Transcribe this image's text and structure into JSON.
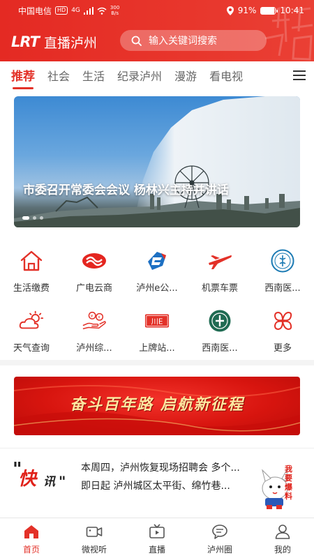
{
  "status_bar": {
    "carrier": "中国电信",
    "hd": "HD",
    "network": "4G",
    "speed_value": "300",
    "speed_unit": "B/s",
    "battery": "91%",
    "battery_level": 0.91,
    "time": "10:41"
  },
  "header": {
    "logo_mark": "LRT",
    "app_name": "直播泸州",
    "search_placeholder": "输入关键词搜索"
  },
  "tabs": [
    {
      "label": "推荐",
      "active": true
    },
    {
      "label": "社会",
      "active": false
    },
    {
      "label": "生活",
      "active": false
    },
    {
      "label": "纪录泸州",
      "active": false
    },
    {
      "label": "漫游",
      "active": false
    },
    {
      "label": "看电视",
      "active": false
    }
  ],
  "banner": {
    "title": "市委召开常委会会议  杨林兴主持并讲话",
    "slide_count": 3,
    "active_slide": 1
  },
  "services": {
    "row1": [
      {
        "label": "生活缴费",
        "icon": "house-icon"
      },
      {
        "label": "广电云商",
        "icon": "cloud-mall-icon"
      },
      {
        "label": "泸州e公...",
        "icon": "bus-e-icon"
      },
      {
        "label": "机票车票",
        "icon": "airplane-icon"
      },
      {
        "label": "西南医...",
        "icon": "hospital-emblem-icon"
      }
    ],
    "row2": [
      {
        "label": "天气查询",
        "icon": "weather-icon"
      },
      {
        "label": "泸州综...",
        "icon": "hand-coins-icon"
      },
      {
        "label": "上牌站...",
        "icon": "license-plate-icon"
      },
      {
        "label": "西南医...",
        "icon": "hospital-emblem-icon"
      },
      {
        "label": "更多",
        "icon": "more-icon"
      }
    ],
    "plate_text": "川E"
  },
  "promo": {
    "slogan": "奋斗百年路  启航新征程"
  },
  "news_flash": {
    "badge_main": "快",
    "badge_sub": "讯",
    "items": [
      "本周四，泸州恢复现场招聘会 多个...",
      "即日起 泸州城区太平街、绵竹巷..."
    ],
    "mascot_text": "我要爆料"
  },
  "bottom_nav": [
    {
      "label": "首页",
      "icon": "home-icon",
      "active": true
    },
    {
      "label": "微视听",
      "icon": "video-camera-icon",
      "active": false
    },
    {
      "label": "直播",
      "icon": "tv-icon",
      "active": false
    },
    {
      "label": "泸州圈",
      "icon": "chat-bubble-icon",
      "active": false
    },
    {
      "label": "我的",
      "icon": "user-icon",
      "active": false
    }
  ],
  "colors": {
    "brand_red": "#e33128",
    "header_red": "#e42a23",
    "text_dark": "#333333"
  }
}
